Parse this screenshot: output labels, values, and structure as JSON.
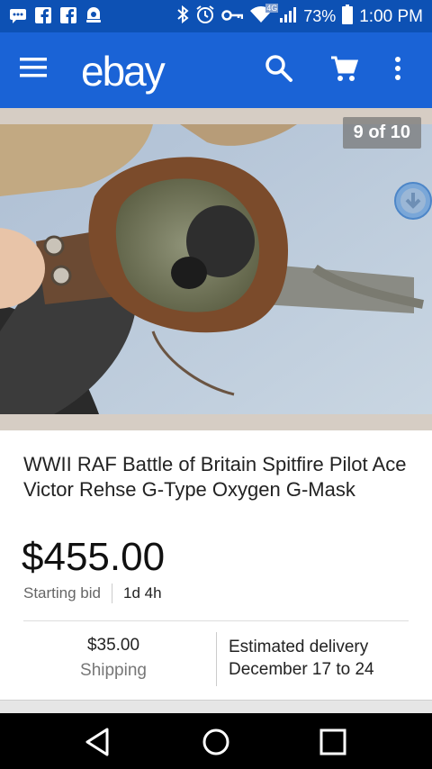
{
  "status_bar": {
    "battery_percent": "73%",
    "time": "1:00 PM",
    "network": "4G",
    "left_icons": [
      "chat-icon",
      "facebook-icon",
      "facebook-icon",
      "ebay-notification-icon"
    ],
    "right_icons": [
      "bluetooth-icon",
      "alarm-icon",
      "vpn-key-icon",
      "wifi-icon",
      "signal-icon",
      "battery-icon"
    ]
  },
  "app_bar": {
    "logo": "ebay",
    "actions": [
      "menu-icon",
      "search-icon",
      "cart-icon",
      "more-vert-icon"
    ],
    "color": "#1a63d6"
  },
  "gallery": {
    "counter": "9 of 10",
    "download_icon": "download-icon"
  },
  "listing": {
    "title": "WWII RAF Battle of Britain Spitfire Pilot Ace Victor Rehse G-Type Oxygen G-Mask",
    "price": "$455.00",
    "bid_label": "Starting bid",
    "time_left": "1d 4h",
    "shipping_cost": "$35.00",
    "shipping_label": "Shipping",
    "delivery_label": "Estimated delivery",
    "delivery_dates": "December 17 to 24"
  },
  "nav_bar": {
    "buttons": [
      "back-icon",
      "home-icon",
      "recents-icon"
    ]
  }
}
